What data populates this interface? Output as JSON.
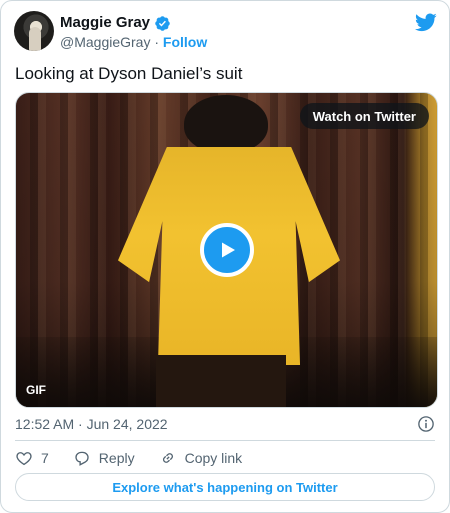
{
  "author": {
    "display_name": "Maggie Gray",
    "handle": "@MaggieGray",
    "separator": "·",
    "follow_label": "Follow"
  },
  "tweet": {
    "text": "Looking at Dyson Daniel’s suit"
  },
  "media": {
    "watch_label": "Watch on Twitter",
    "badge": "GIF"
  },
  "meta": {
    "timestamp": "12:52 AM · Jun 24, 2022"
  },
  "actions": {
    "like_count": "7",
    "reply_label": "Reply",
    "copy_link_label": "Copy link"
  },
  "footer": {
    "explore_label": "Explore what's happening on Twitter"
  },
  "colors": {
    "accent": "#1d9bf0",
    "text": "#0f1419",
    "muted": "#536471",
    "border": "#cfd9de"
  },
  "icons": [
    "verified-badge-icon",
    "twitter-logo-icon",
    "play-icon",
    "info-icon",
    "heart-icon",
    "reply-icon",
    "link-icon"
  ]
}
